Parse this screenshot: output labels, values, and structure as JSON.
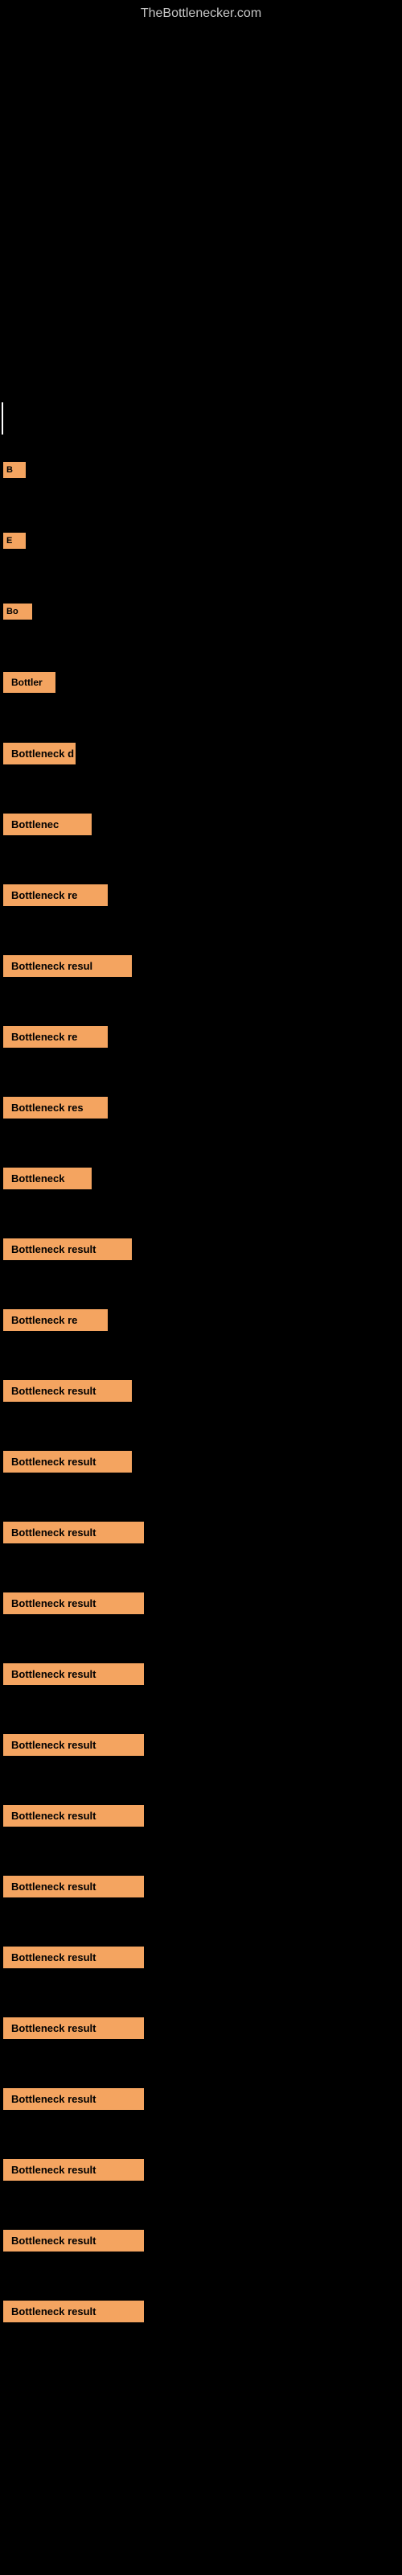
{
  "site": {
    "title": "TheBottlenecker.com"
  },
  "results": [
    {
      "id": 1,
      "label": "B",
      "badgeClass": "badge-xs"
    },
    {
      "id": 2,
      "label": "E",
      "badgeClass": "badge-xs"
    },
    {
      "id": 3,
      "label": "Bo",
      "badgeClass": "badge-sm"
    },
    {
      "id": 4,
      "label": "Bottler",
      "badgeClass": "badge-md"
    },
    {
      "id": 5,
      "label": "Bottleneck d",
      "badgeClass": "badge-lg"
    },
    {
      "id": 6,
      "label": "Bottlenec",
      "badgeClass": "badge-xl"
    },
    {
      "id": 7,
      "label": "Bottleneck re",
      "badgeClass": "badge-xxl"
    },
    {
      "id": 8,
      "label": "Bottleneck resul",
      "badgeClass": "badge-full"
    },
    {
      "id": 9,
      "label": "Bottleneck re",
      "badgeClass": "badge-xxl"
    },
    {
      "id": 10,
      "label": "Bottleneck res",
      "badgeClass": "badge-xxl"
    },
    {
      "id": 11,
      "label": "Bottleneck",
      "badgeClass": "badge-xl"
    },
    {
      "id": 12,
      "label": "Bottleneck result",
      "badgeClass": "badge-full"
    },
    {
      "id": 13,
      "label": "Bottleneck re",
      "badgeClass": "badge-xxl"
    },
    {
      "id": 14,
      "label": "Bottleneck result",
      "badgeClass": "badge-full"
    },
    {
      "id": 15,
      "label": "Bottleneck result",
      "badgeClass": "badge-full"
    },
    {
      "id": 16,
      "label": "Bottleneck result",
      "badgeClass": "badge-wider"
    },
    {
      "id": 17,
      "label": "Bottleneck result",
      "badgeClass": "badge-wider"
    },
    {
      "id": 18,
      "label": "Bottleneck result",
      "badgeClass": "badge-wider"
    },
    {
      "id": 19,
      "label": "Bottleneck result",
      "badgeClass": "badge-wider"
    },
    {
      "id": 20,
      "label": "Bottleneck result",
      "badgeClass": "badge-wider"
    },
    {
      "id": 21,
      "label": "Bottleneck result",
      "badgeClass": "badge-wider"
    },
    {
      "id": 22,
      "label": "Bottleneck result",
      "badgeClass": "badge-wider"
    },
    {
      "id": 23,
      "label": "Bottleneck result",
      "badgeClass": "badge-wider"
    },
    {
      "id": 24,
      "label": "Bottleneck result",
      "badgeClass": "badge-wider"
    },
    {
      "id": 25,
      "label": "Bottleneck result",
      "badgeClass": "badge-wider"
    },
    {
      "id": 26,
      "label": "Bottleneck result",
      "badgeClass": "badge-wider"
    },
    {
      "id": 27,
      "label": "Bottleneck result",
      "badgeClass": "badge-wider"
    }
  ]
}
